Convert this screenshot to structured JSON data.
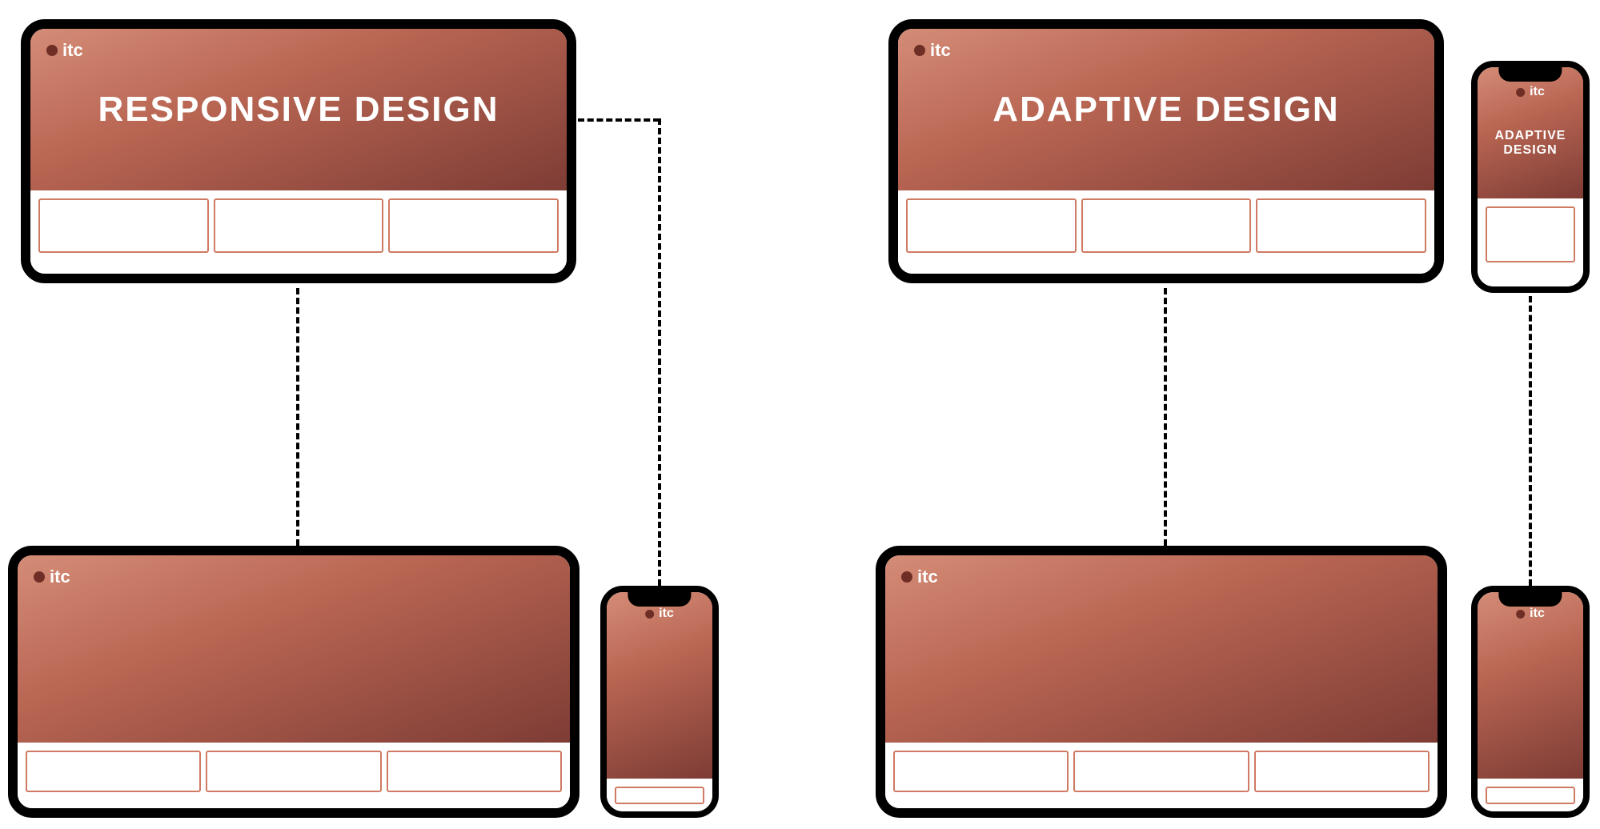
{
  "brand": "itc",
  "left": {
    "title": "RESPONSIVE DESIGN",
    "desktop_cards": 3,
    "tablet_cards": 3,
    "phone_cards": 1
  },
  "right": {
    "title": "ADAPTIVE DESIGN",
    "desktop_cards": 3,
    "tablet_cards": 3,
    "phone_top_cards": 1,
    "phone_bottom_cards": 1
  },
  "colors": {
    "frame": "#000000",
    "card_border": "#cf7a63",
    "gradient_from": "#d48c77",
    "gradient_to": "#7e3c35"
  }
}
